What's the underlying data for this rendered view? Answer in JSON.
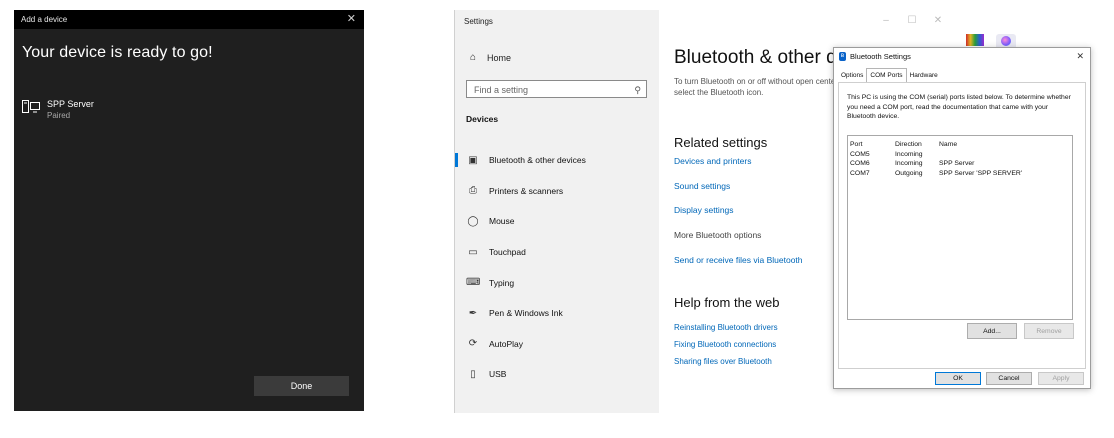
{
  "add_device": {
    "title": "Add a device",
    "close_glyph": "✕",
    "headline": "Your device is ready to go!",
    "device": {
      "name": "SPP Server",
      "status": "Paired",
      "icon": "computer-device-icon"
    },
    "done_label": "Done"
  },
  "settings": {
    "window_title": "Settings",
    "controls": {
      "minimize": "–",
      "maximize": "☐",
      "close": "✕"
    },
    "home_label": "Home",
    "search_placeholder": "Find a setting",
    "section_header": "Devices",
    "nav_items": [
      {
        "label": "Bluetooth & other devices",
        "icon": "bluetooth-devices-icon",
        "glyph": "▣"
      },
      {
        "label": "Printers & scanners",
        "icon": "printer-icon",
        "glyph": "⎙"
      },
      {
        "label": "Mouse",
        "icon": "mouse-icon",
        "glyph": "◯"
      },
      {
        "label": "Touchpad",
        "icon": "touchpad-icon",
        "glyph": "▭"
      },
      {
        "label": "Typing",
        "icon": "keyboard-icon",
        "glyph": "⌨"
      },
      {
        "label": "Pen & Windows Ink",
        "icon": "pen-icon",
        "glyph": "✒"
      },
      {
        "label": "AutoPlay",
        "icon": "autoplay-icon",
        "glyph": "⟳"
      },
      {
        "label": "USB",
        "icon": "usb-icon",
        "glyph": "▯"
      }
    ],
    "main": {
      "title": "Bluetooth & other de",
      "subtitle": "To turn Bluetooth on or off without open center and select the Bluetooth icon.",
      "related_title": "Related settings",
      "related_links": [
        "Devices and printers",
        "Sound settings",
        "Display settings",
        "More Bluetooth options",
        "Send or receive files via Bluetooth"
      ],
      "help_title": "Help from the web",
      "help_links": [
        "Reinstalling Bluetooth drivers",
        "Fixing Bluetooth connections",
        "Sharing files over Bluetooth"
      ]
    }
  },
  "bt_dialog": {
    "title": "Bluetooth Settings",
    "close_glyph": "✕",
    "tabs": [
      "Options",
      "COM Ports",
      "Hardware"
    ],
    "active_tab": "COM Ports",
    "description": "This PC is using the COM (serial) ports listed below. To determine whether you need a COM port, read the documentation that came with your Bluetooth device.",
    "columns": [
      "Port",
      "Direction",
      "Name"
    ],
    "rows": [
      [
        "COM5",
        "Incoming",
        ""
      ],
      [
        "COM6",
        "Incoming",
        "SPP Server"
      ],
      [
        "COM7",
        "Outgoing",
        "SPP Server 'SPP SERVER'"
      ]
    ],
    "add_label": "Add...",
    "remove_label": "Remove",
    "ok_label": "OK",
    "cancel_label": "Cancel",
    "apply_label": "Apply"
  },
  "colors": {
    "accent": "#0078d7",
    "link": "#0067b8",
    "dark_bg": "#1f1f1f"
  }
}
